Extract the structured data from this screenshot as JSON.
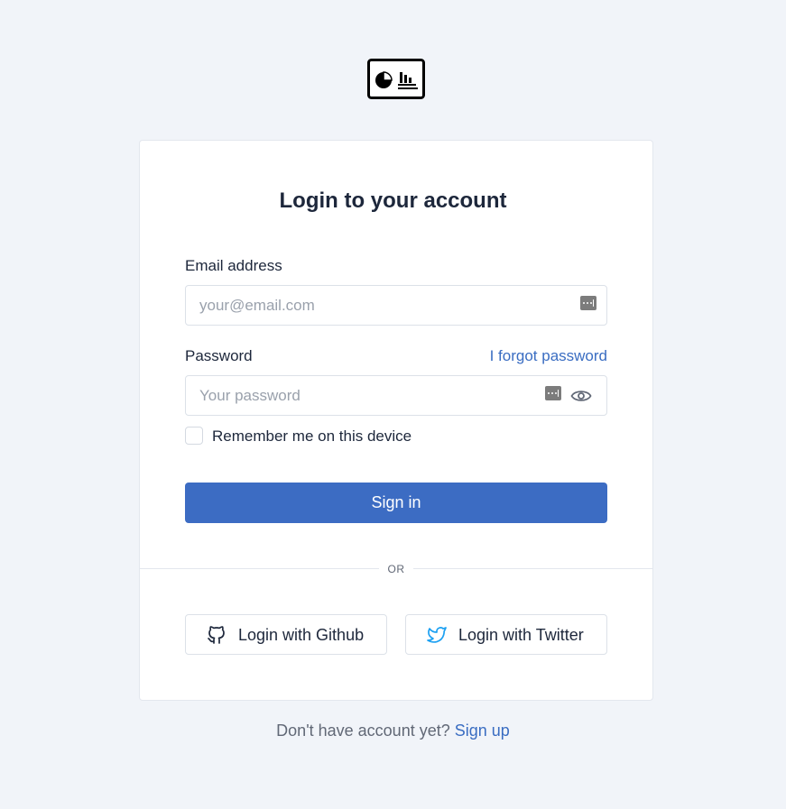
{
  "logo": {
    "icon": "dashboard-chart-icon"
  },
  "card": {
    "title": "Login to your account",
    "email": {
      "label": "Email address",
      "placeholder": "your@email.com",
      "icon": "password-manager-icon"
    },
    "password": {
      "label": "Password",
      "forgot_link": "I forgot password",
      "placeholder": "Your password",
      "icon": "password-manager-icon",
      "toggle_icon": "eye-icon"
    },
    "remember_label": "Remember me on this device",
    "submit_label": "Sign in",
    "divider_text": "OR",
    "social": [
      {
        "label": "Login with Github",
        "icon": "github-icon"
      },
      {
        "label": "Login with Twitter",
        "icon": "twitter-icon",
        "icon_color": "#1da1f2"
      }
    ]
  },
  "footer": {
    "text": "Don't have account yet?",
    "link": "Sign up"
  },
  "colors": {
    "background": "#f1f4f9",
    "primary": "#3c6cc3",
    "link": "#3a6dc2"
  }
}
